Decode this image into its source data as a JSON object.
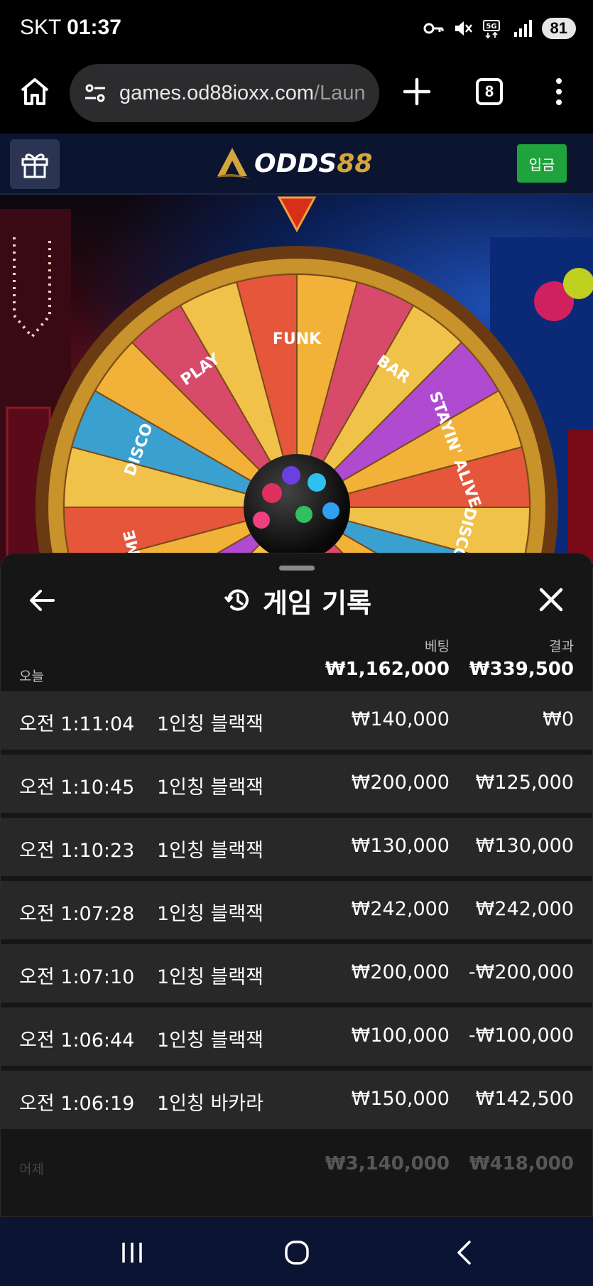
{
  "status_bar": {
    "carrier": "SKT",
    "time": "01:37",
    "battery": "81"
  },
  "browser": {
    "url_host": "games.od88ioxx.com",
    "url_path": "/Laun",
    "tab_count": "8"
  },
  "site_header": {
    "logo_part1": "ODDS",
    "logo_part2": "88",
    "deposit_label": "입금"
  },
  "sheet": {
    "title": "게임 기록",
    "columns": {
      "bet": "베팅",
      "result": "결과"
    },
    "today": {
      "label": "오늘",
      "bet_total": "₩1,162,000",
      "result_total": "₩339,500"
    },
    "rows": [
      {
        "time": "오전 1:11:04",
        "game": "1인칭 블랙잭",
        "bet": "₩140,000",
        "result": "₩0"
      },
      {
        "time": "오전 1:10:45",
        "game": "1인칭 블랙잭",
        "bet": "₩200,000",
        "result": "₩125,000"
      },
      {
        "time": "오전 1:10:23",
        "game": "1인칭 블랙잭",
        "bet": "₩130,000",
        "result": "₩130,000"
      },
      {
        "time": "오전 1:07:28",
        "game": "1인칭 블랙잭",
        "bet": "₩242,000",
        "result": "₩242,000"
      },
      {
        "time": "오전 1:07:10",
        "game": "1인칭 블랙잭",
        "bet": "₩200,000",
        "result": "-₩200,000"
      },
      {
        "time": "오전 1:06:44",
        "game": "1인칭 블랙잭",
        "bet": "₩100,000",
        "result": "-₩100,000"
      },
      {
        "time": "오전 1:06:19",
        "game": "1인칭 바카라",
        "bet": "₩150,000",
        "result": "₩142,500"
      }
    ],
    "yesterday": {
      "label": "어제",
      "bet_total": "₩3,140,000",
      "result_total": "₩418,000"
    }
  },
  "wheel_labels": [
    "TIME",
    "DISCO",
    "PLAY",
    "FUNK",
    "BAR",
    "STAYIN' ALIVE",
    "DISCO VIP"
  ],
  "colors": {
    "accent_green": "#1fa33c",
    "brand_gold": "#d4a53a",
    "header_navy": "#0c1530",
    "sheet_bg": "#161616",
    "row_bg": "#282828"
  }
}
